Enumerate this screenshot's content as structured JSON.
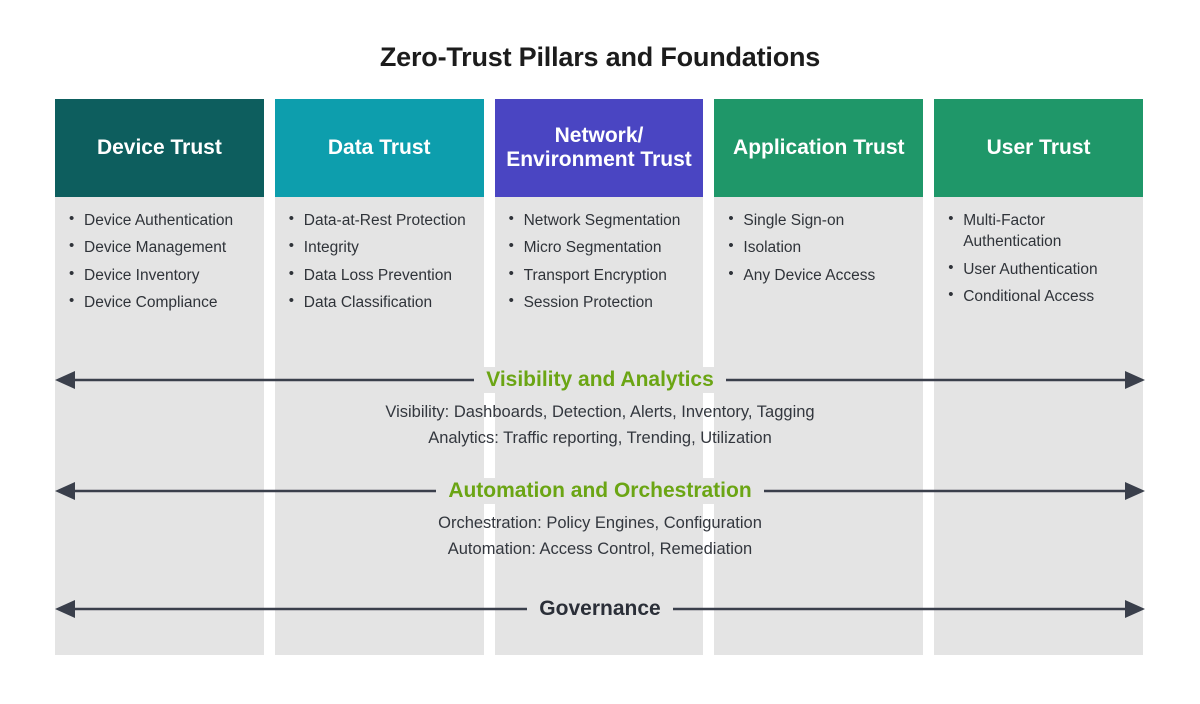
{
  "title": "Zero-Trust Pillars and Foundations",
  "colors": {
    "device_trust": "#0d5e5e",
    "data_trust": "#0d9ead",
    "network_trust": "#4a45c2",
    "application_trust": "#1f9769",
    "user_trust": "#1f9769",
    "column_background": "#e4e4e4",
    "foundation_accent": "#6ba514",
    "governance_text": "#2b2f38",
    "arrow": "#3a3f4b",
    "page_background": "#ffffff"
  },
  "pillars": [
    {
      "id": "device-trust",
      "title": "Device Trust",
      "header_color": "#0d5e5e",
      "bullets": [
        "Device Authentication",
        "Device Management",
        "Device Inventory",
        "Device Compliance"
      ]
    },
    {
      "id": "data-trust",
      "title": "Data Trust",
      "header_color": "#0d9ead",
      "bullets": [
        "Data-at-Rest Protection",
        "Integrity",
        "Data Loss Prevention",
        "Data Classification"
      ]
    },
    {
      "id": "network-environment-trust",
      "title": "Network/ Environment Trust",
      "header_color": "#4a45c2",
      "bullets": [
        "Network Segmentation",
        "Micro Segmentation",
        "Transport Encryption",
        "Session Protection"
      ]
    },
    {
      "id": "application-trust",
      "title": "Application Trust",
      "header_color": "#1f9769",
      "bullets": [
        "Single Sign-on",
        "Isolation",
        "Any Device Access"
      ]
    },
    {
      "id": "user-trust",
      "title": "User Trust",
      "header_color": "#1f9769",
      "bullets": [
        "Multi-Factor Authentication",
        "User Authentication",
        "Conditional Access"
      ]
    }
  ],
  "foundations": [
    {
      "id": "visibility-and-analytics",
      "label": "Visibility and Analytics",
      "label_color": "#6ba514",
      "lines": [
        "Visibility: Dashboards, Detection, Alerts, Inventory, Tagging",
        "Analytics: Traffic reporting, Trending, Utilization"
      ]
    },
    {
      "id": "automation-and-orchestration",
      "label": "Automation and Orchestration",
      "label_color": "#6ba514",
      "lines": [
        "Orchestration: Policy Engines, Configuration",
        "Automation: Access Control, Remediation"
      ]
    },
    {
      "id": "governance",
      "label": "Governance",
      "label_color": "#2b2f38",
      "lines": []
    }
  ]
}
